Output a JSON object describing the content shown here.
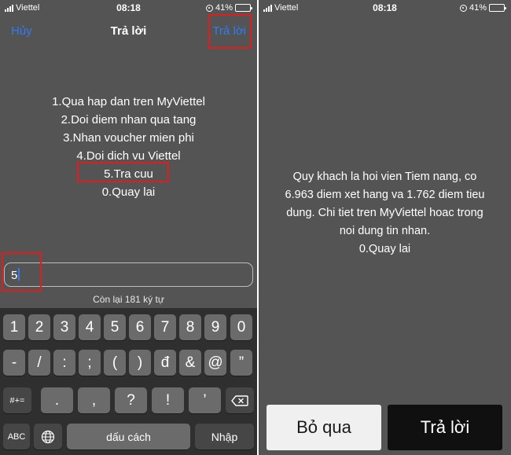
{
  "left": {
    "status": {
      "carrier": "Viettel",
      "time": "08:18",
      "battery": "41%",
      "battery_level": 0.41
    },
    "nav": {
      "cancel": "Hủy",
      "title": "Trả lời",
      "reply": "Trả lời"
    },
    "menu": [
      "1.Qua hap dan tren MyViettel",
      "2.Doi diem nhan qua tang",
      "3.Nhan voucher mien phi",
      "4.Doi dich vu Viettel",
      "5.Tra cuu",
      "0.Quay lai"
    ],
    "input_value": "5",
    "counter": "Còn lại 181 ký tự",
    "keyboard": {
      "row1": [
        "1",
        "2",
        "3",
        "4",
        "5",
        "6",
        "7",
        "8",
        "9",
        "0"
      ],
      "row2": [
        "-",
        "/",
        ":",
        ";",
        "(",
        ")",
        "đ",
        "&",
        "@",
        "”"
      ],
      "row3_left": "#+=",
      "row3": [
        ".",
        ",",
        "?",
        "!",
        "’"
      ],
      "row4": {
        "abc": "ABC",
        "space": "dấu cách",
        "enter": "Nhập"
      }
    }
  },
  "right": {
    "status": {
      "carrier": "Viettel",
      "time": "08:18",
      "battery": "41%",
      "battery_level": 0.41
    },
    "message": [
      "Quy khach la hoi vien Tiem nang, co",
      "6.963 diem xet hang va 1.762 diem tieu",
      "dung. Chi tiet tren MyViettel hoac trong",
      "noi dung tin nhan.",
      "0.Quay lai"
    ],
    "skip": "Bỏ qua",
    "reply": "Trả lời"
  },
  "colors": {
    "highlight": "#e21b1b",
    "ios_blue": "#2e7cf6",
    "battery": "#f2c400"
  }
}
